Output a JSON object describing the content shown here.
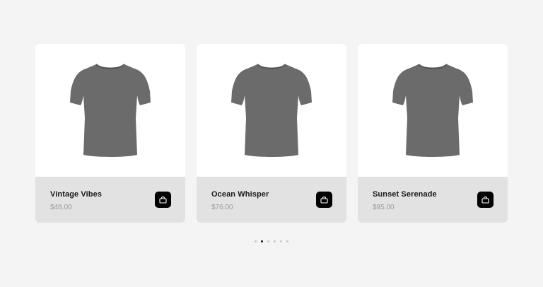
{
  "products": [
    {
      "name": "Vintage Vibes",
      "price": "$48.00",
      "image_icon": "tshirt-icon",
      "cart_icon": "shopping-bag-icon"
    },
    {
      "name": "Ocean Whisper",
      "price": "$76.00",
      "image_icon": "tshirt-icon",
      "cart_icon": "shopping-bag-icon"
    },
    {
      "name": "Sunset Serenade",
      "price": "$95.00",
      "image_icon": "tshirt-icon",
      "cart_icon": "shopping-bag-icon"
    }
  ],
  "pagination": {
    "total": 6,
    "active_index": 1
  },
  "colors": {
    "shirt": "#6b6b6b",
    "accent": "#000000",
    "card_footer": "#e2e2e2"
  }
}
